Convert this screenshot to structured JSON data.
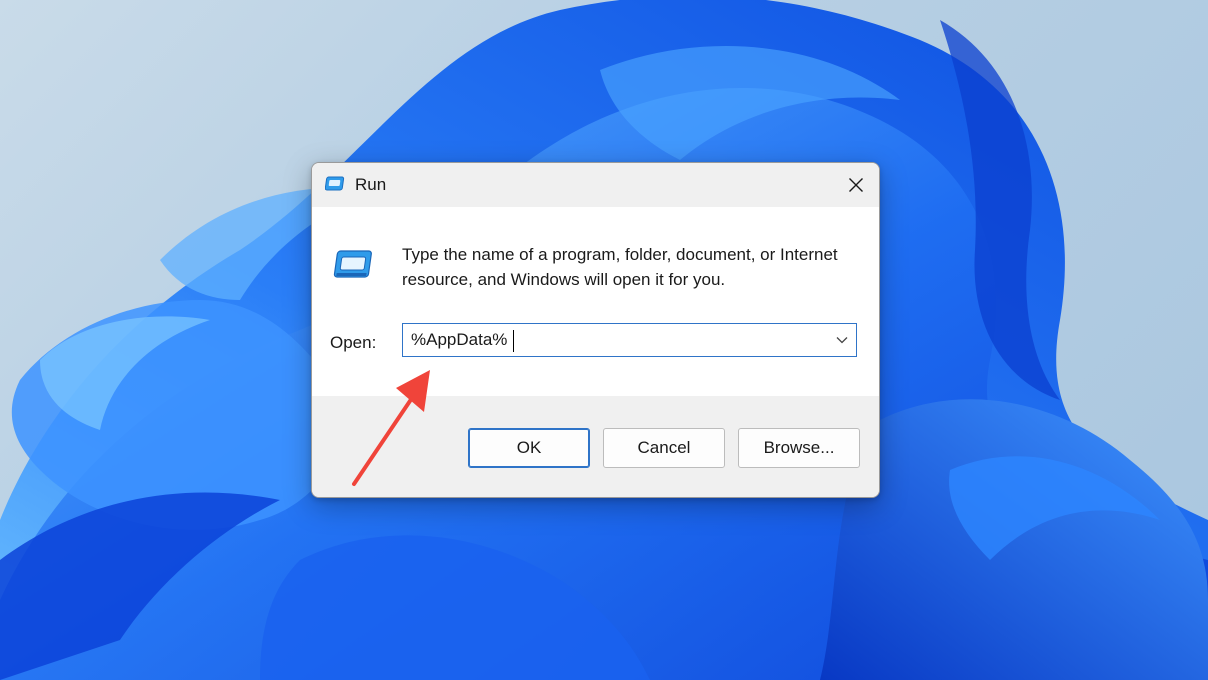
{
  "desktop": {
    "wallpaper_colors": {
      "background": "#b8d0e4",
      "bloom_dark": "#0a3fd6",
      "bloom_mid": "#1f6ef2",
      "bloom_light": "#4aa3ff"
    }
  },
  "dialog": {
    "title": "Run",
    "title_icon": "run-icon",
    "close_icon": "close-icon",
    "description": "Type the name of a program, folder, document, or Internet resource, and Windows will open it for you.",
    "open_label": "Open:",
    "open_value": "%AppData%",
    "dropdown_icon": "chevron-down-icon",
    "buttons": {
      "ok": "OK",
      "cancel": "Cancel",
      "browse": "Browse..."
    },
    "accent_color": "#2f74c8"
  },
  "annotation": {
    "arrow_color": "#f0443a"
  }
}
